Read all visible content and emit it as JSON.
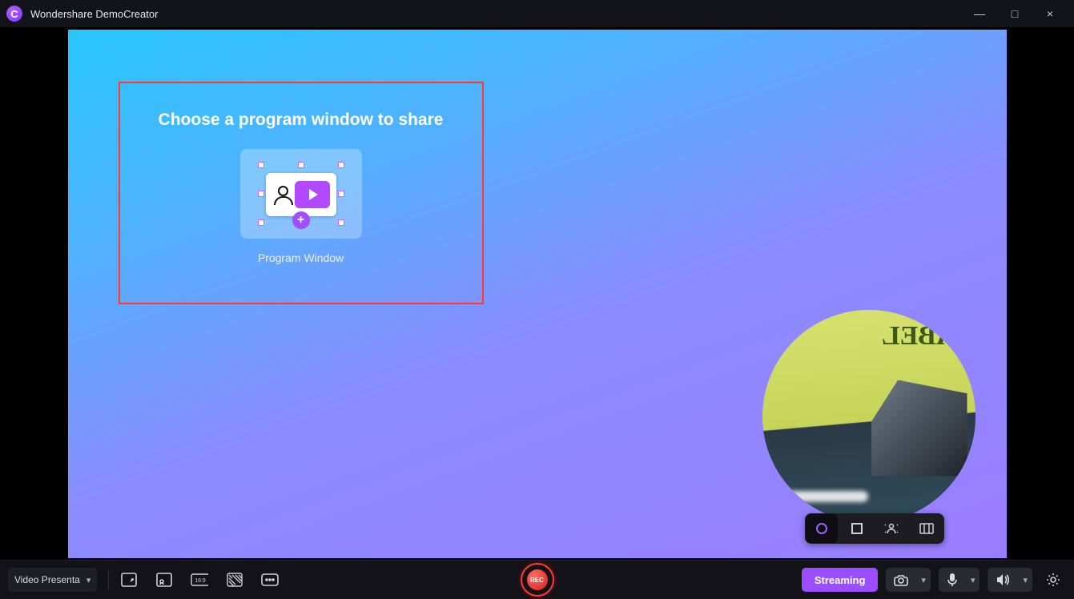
{
  "app": {
    "name": "Wondershare DemoCreator",
    "logo_letter": "C"
  },
  "window_controls": {
    "min": "—",
    "max": "□",
    "close": "×"
  },
  "dialog": {
    "title": "Choose a program window to share",
    "option_label": "Program Window"
  },
  "webcam": {
    "ink_text": "ABEL"
  },
  "webcam_ctrls": [
    "circle",
    "square",
    "person",
    "frame"
  ],
  "bottom": {
    "mode": "Video Presenta",
    "stream_label": "Streaming",
    "rec_label": "REC"
  }
}
